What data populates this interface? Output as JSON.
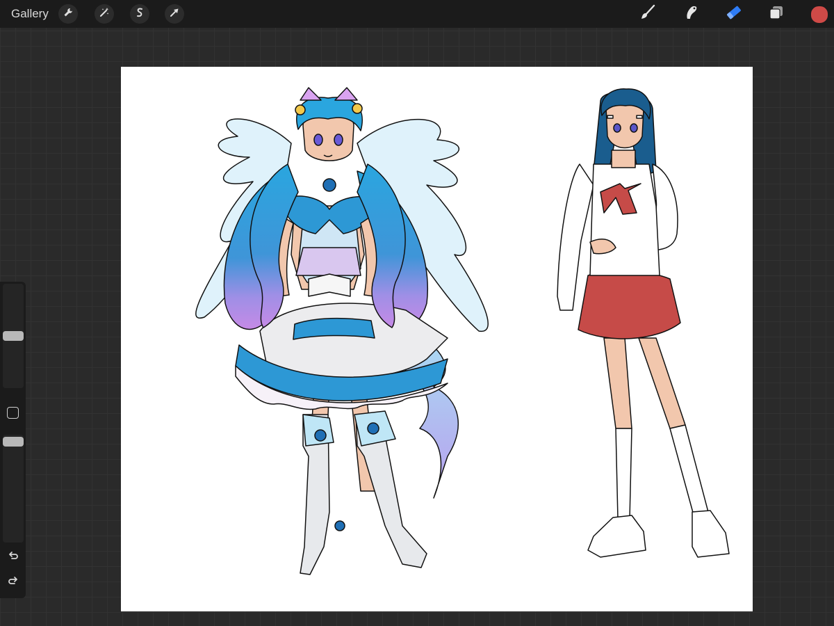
{
  "app": {
    "gallery_label": "Gallery"
  },
  "toolbar_left": {
    "icons": [
      "wrench-icon",
      "magic-wand-icon",
      "selection-icon",
      "transform-arrow-icon"
    ]
  },
  "toolbar_right": {
    "icons": [
      "brush-icon",
      "smudge-icon",
      "eraser-icon",
      "layers-icon"
    ],
    "active_tool": "eraser",
    "active_color": "#cf4a47",
    "accent": "#2e7cf6"
  },
  "sidebar": {
    "brush_size_level": 0.5,
    "opacity_level": 0.98,
    "icons": [
      "modifier-square-icon",
      "undo-icon",
      "redo-icon"
    ]
  },
  "canvas": {
    "background": "#ffffff"
  }
}
